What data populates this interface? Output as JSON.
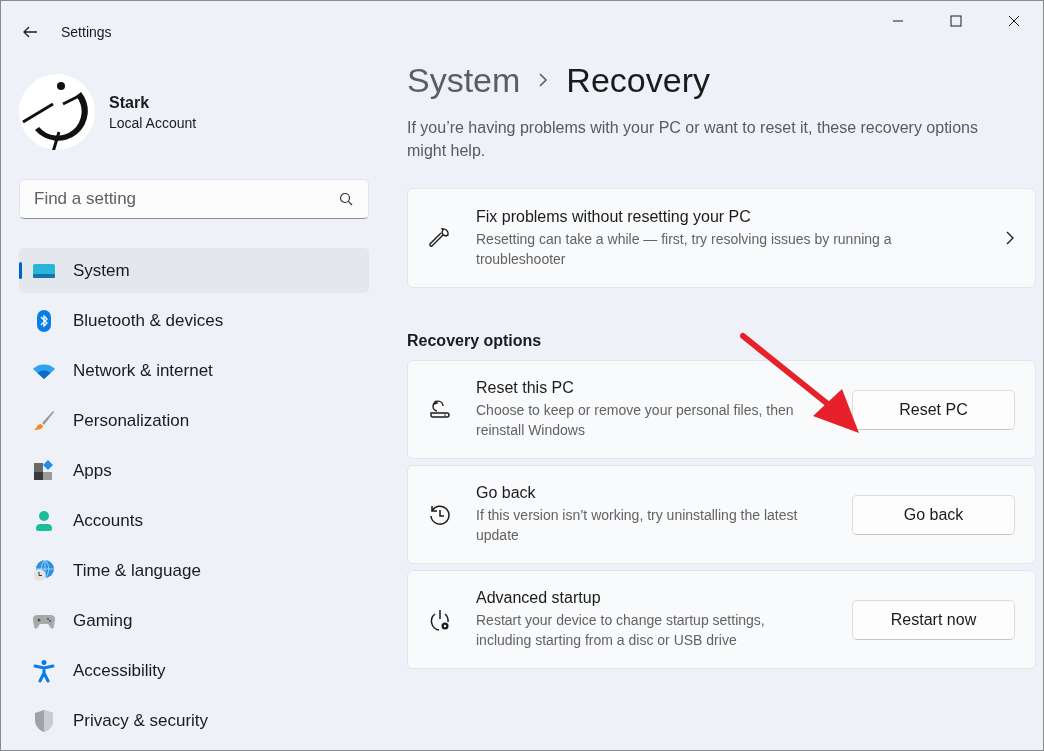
{
  "window": {
    "title": "Settings"
  },
  "account": {
    "name": "Stark",
    "type": "Local Account"
  },
  "search": {
    "placeholder": "Find a setting"
  },
  "sidebar": {
    "items": [
      {
        "label": "System",
        "selected": true
      },
      {
        "label": "Bluetooth & devices",
        "selected": false
      },
      {
        "label": "Network & internet",
        "selected": false
      },
      {
        "label": "Personalization",
        "selected": false
      },
      {
        "label": "Apps",
        "selected": false
      },
      {
        "label": "Accounts",
        "selected": false
      },
      {
        "label": "Time & language",
        "selected": false
      },
      {
        "label": "Gaming",
        "selected": false
      },
      {
        "label": "Accessibility",
        "selected": false
      },
      {
        "label": "Privacy & security",
        "selected": false
      }
    ]
  },
  "breadcrumb": {
    "parent": "System",
    "current": "Recovery"
  },
  "description": "If you’re having problems with your PC or want to reset it, these recovery options might help.",
  "fix_card": {
    "title": "Fix problems without resetting your PC",
    "subtitle": "Resetting can take a while — first, try resolving issues by running a troubleshooter"
  },
  "section_title": "Recovery options",
  "options": [
    {
      "title": "Reset this PC",
      "subtitle": "Choose to keep or remove your personal files, then reinstall Windows",
      "button": "Reset PC"
    },
    {
      "title": "Go back",
      "subtitle": "If this version isn’t working, try uninstalling the latest update",
      "button": "Go back"
    },
    {
      "title": "Advanced startup",
      "subtitle": "Restart your device to change startup settings, including starting from a disc or USB drive",
      "button": "Restart now"
    }
  ]
}
